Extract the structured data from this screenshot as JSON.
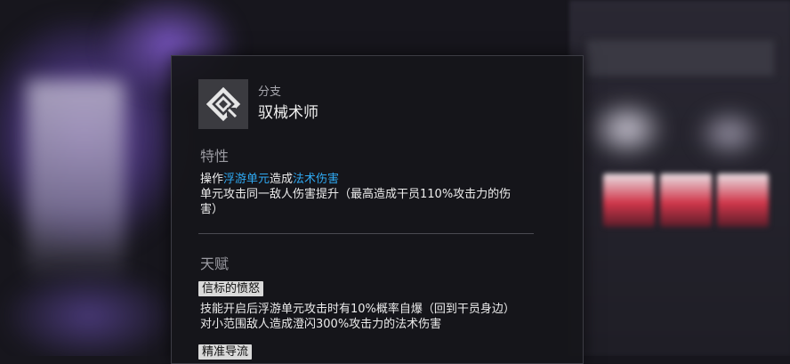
{
  "header": {
    "subtitle": "分支",
    "title": "驭械术师",
    "icon": "branch-icon"
  },
  "trait": {
    "title": "特性",
    "line1_prefix": "操作",
    "line1_hl1": "浮游单元",
    "line1_mid": "造成",
    "line1_hl2": "法术伤害",
    "line2": "单元攻击同一敌人伤害提升（最高造成干员110%攻击力的伤",
    "line3": "害）"
  },
  "talents": {
    "title": "天赋",
    "items": [
      {
        "name": "信标的愤怒",
        "line1": "技能开启后浮游单元攻击时有10%概率自爆（回到干员身边）",
        "line2": "对小范围敌人造成澄闪300%攻击力的法术伤害"
      },
      {
        "name": "精准导流"
      }
    ]
  },
  "colors": {
    "highlight": "#2fa9f2",
    "panel_bg": "#16161a",
    "label_bg": "#d9d9d9"
  }
}
